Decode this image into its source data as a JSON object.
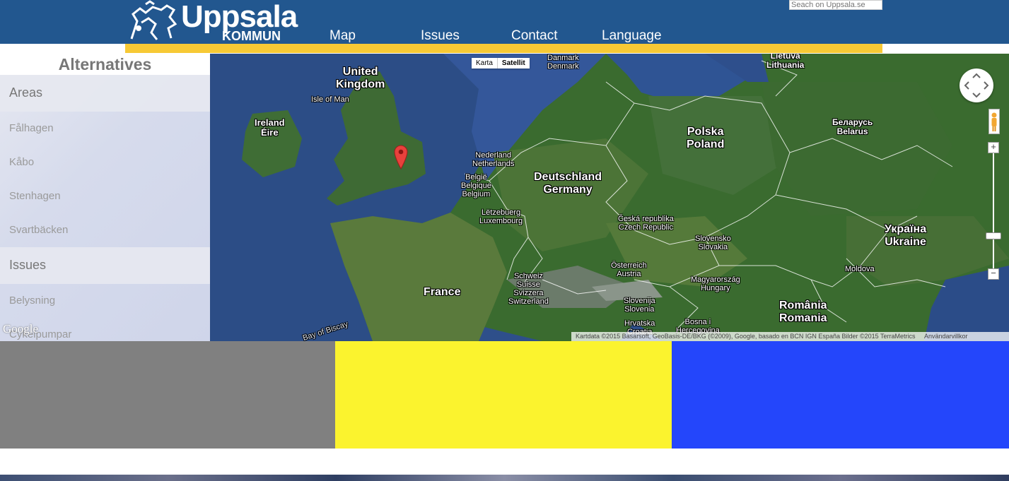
{
  "header": {
    "logo_text": "Uppsala",
    "logo_subtext": "KOMMUN",
    "nav": [
      "Map",
      "Issues",
      "Contact",
      "Language"
    ],
    "search_placeholder": "Seach on Uppsala.se",
    "colors": {
      "header_bg": "#22578f",
      "accent_bar": "#f7c935"
    }
  },
  "sidebar": {
    "title": "Alternatives",
    "sections": [
      {
        "label": "Areas",
        "items": [
          "Fålhagen",
          "Kåbo",
          "Stenhagen",
          "Svartbäcken"
        ]
      },
      {
        "label": "Issues",
        "items": [
          "Belysning",
          "Cykelpumpar"
        ]
      }
    ]
  },
  "map": {
    "type_toggle": [
      "Karta",
      "Satellit"
    ],
    "active_type": "Satellit",
    "labels": {
      "uk": "United\nKingdom",
      "isle_of_man": "Isle of Man",
      "ireland": "Ireland\nÉire",
      "denmark": "Danmark\nDenmark",
      "lithuania": "Lietuva\nLithuania",
      "netherlands": "Nederland\nNetherlands",
      "belgium": "België\nBelgique\nBelgium",
      "luxembourg": "Lëtzebuerg\nLuxembourg",
      "germany": "Deutschland\nGermany",
      "poland": "Polska\nPoland",
      "belarus": "Беларусь\nBelarus",
      "czech": "Česká republika\nCzech Republic",
      "slovakia": "Slovensko\nSlovakia",
      "ukraine": "Україна\nUkraine",
      "moldova": "Moldova",
      "france": "France",
      "switzerland": "Schweiz\nSuisse\nSvizzera\nSwitzerland",
      "austria": "Österreich\nAustria",
      "hungary": "Magyarország\nHungary",
      "slovenia": "Slovenija\nSlovenia",
      "croatia": "Hrvatska\nCroatia",
      "bosnia": "Bosna i\nHercegovina",
      "romania": "România\nRomania",
      "biscay": "Bay of Biscay"
    },
    "google_watermark": "Google",
    "attribution": "Kartdata ©2015 Basarsoft, GeoBasis-DE/BKG (©2009), Google, basado en BCN IGN España Bilder ©2015 TerraMetrics",
    "terms": "Användarvillkor"
  },
  "bottom_panels": {
    "colors": [
      "#808080",
      "#fbf32e",
      "#2446fb"
    ]
  }
}
